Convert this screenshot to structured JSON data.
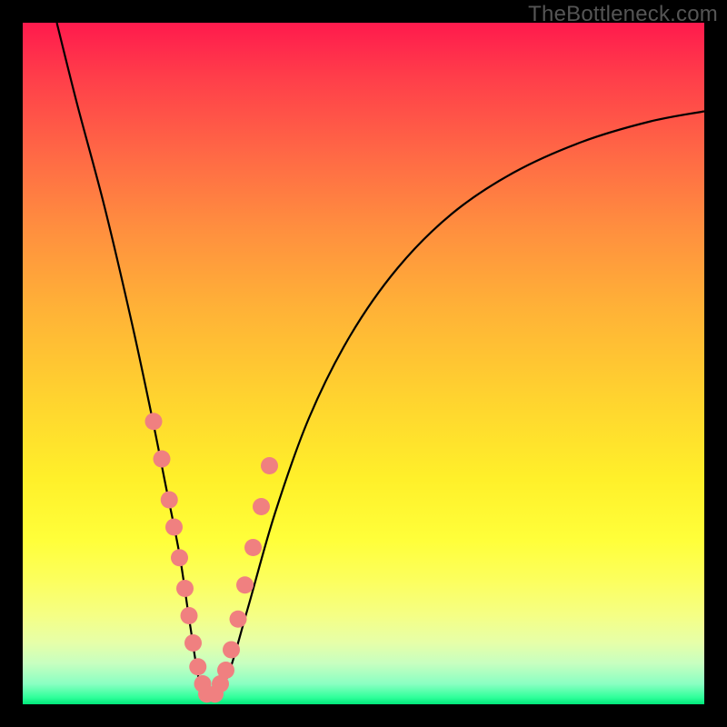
{
  "watermark": "TheBottleneck.com",
  "chart_data": {
    "type": "line",
    "title": "",
    "xlabel": "",
    "ylabel": "",
    "xlim": [
      0,
      100
    ],
    "ylim": [
      0,
      100
    ],
    "series": [
      {
        "name": "bottleneck-curve",
        "x": [
          5,
          8,
          12,
          16,
          19,
          21,
          23,
          24.5,
          26,
          27.5,
          30,
          33,
          37,
          42,
          48,
          55,
          63,
          72,
          82,
          92,
          100
        ],
        "y": [
          100,
          88,
          73,
          56,
          42,
          32,
          22,
          12,
          3,
          1,
          4,
          14,
          28,
          42,
          54,
          64,
          72,
          78,
          82.5,
          85.5,
          87
        ]
      }
    ],
    "markers_left": {
      "name": "left-branch-dots",
      "x": [
        19.2,
        20.4,
        21.5,
        22.2,
        23.0,
        23.8,
        24.4,
        25.0,
        25.7,
        26.4,
        27.0
      ],
      "y": [
        41.5,
        36.0,
        30.0,
        26.0,
        21.5,
        17.0,
        13.0,
        9.0,
        5.5,
        3.0,
        1.5
      ]
    },
    "markers_right": {
      "name": "right-branch-dots",
      "x": [
        28.2,
        29.0,
        29.8,
        30.6,
        31.6,
        32.6,
        33.8,
        35.0,
        36.2
      ],
      "y": [
        1.5,
        3.0,
        5.0,
        8.0,
        12.5,
        17.5,
        23.0,
        29.0,
        35.0
      ]
    },
    "colors": {
      "curve": "#000000",
      "marker_fill": "#f08080",
      "marker_stroke": "#e26a6a"
    }
  }
}
